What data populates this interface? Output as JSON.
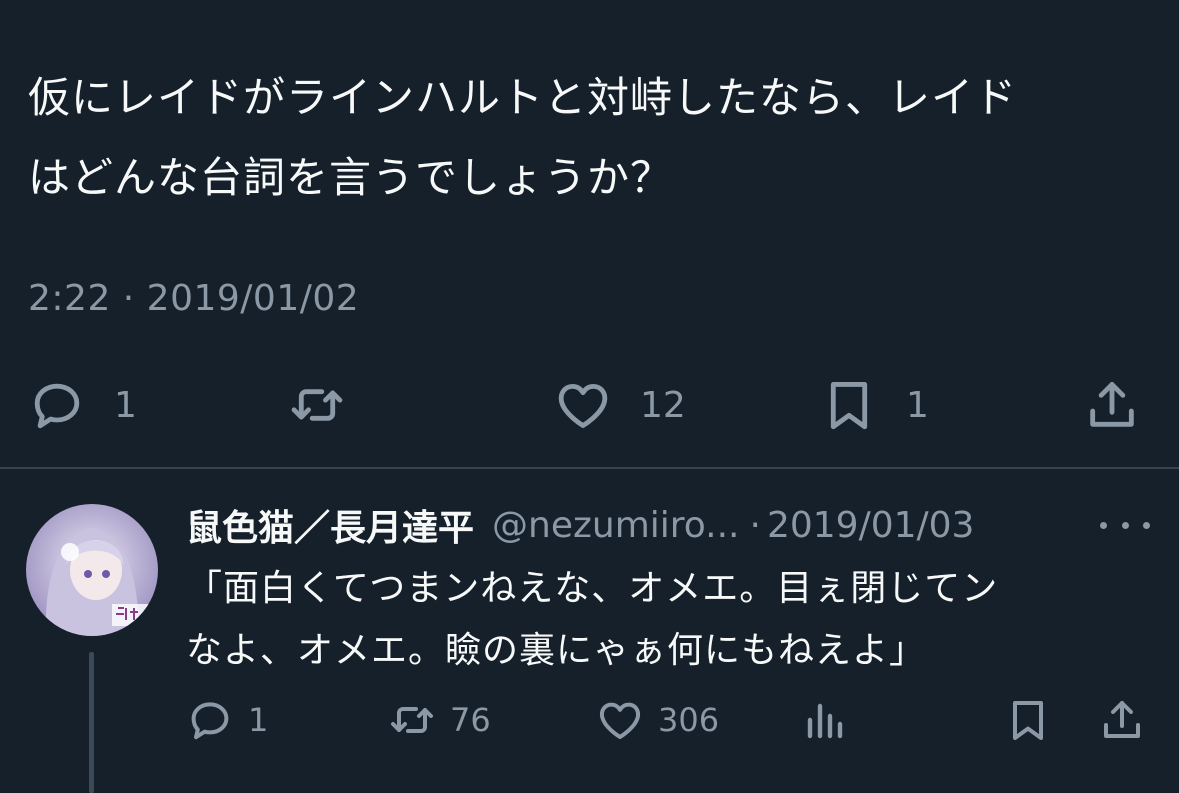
{
  "tweet": {
    "text": "仮にレイドがラインハルトと対峙したなら、レイド\nはどんな台詞を言うでしょうか？",
    "timestamp": "2:22 · 2019/01/02",
    "actions": {
      "reply_count": "1",
      "retweet_count": "",
      "like_count": "12",
      "bookmark_count": "1"
    }
  },
  "reply": {
    "author_name": "鼠色猫／長月達平",
    "handle": "@nezumiiro...",
    "separator": "·",
    "date": "2019/01/03",
    "text": "「面白くてつまンねえな、オメエ。目ぇ閉じてン\nなよ、オメエ。瞼の裏にゃぁ何にもねえよ」",
    "actions": {
      "reply_count": "1",
      "retweet_count": "76",
      "like_count": "306"
    }
  },
  "icons": {
    "reply": "reply-icon",
    "retweet": "retweet-icon",
    "like": "heart-icon",
    "bookmark": "bookmark-icon",
    "share": "share-icon",
    "views": "views-icon",
    "more": "more-icon"
  },
  "colors": {
    "background": "#15202b",
    "text_primary": "#f7f9f9",
    "text_secondary": "#8b98a5",
    "divider": "#38444d"
  }
}
